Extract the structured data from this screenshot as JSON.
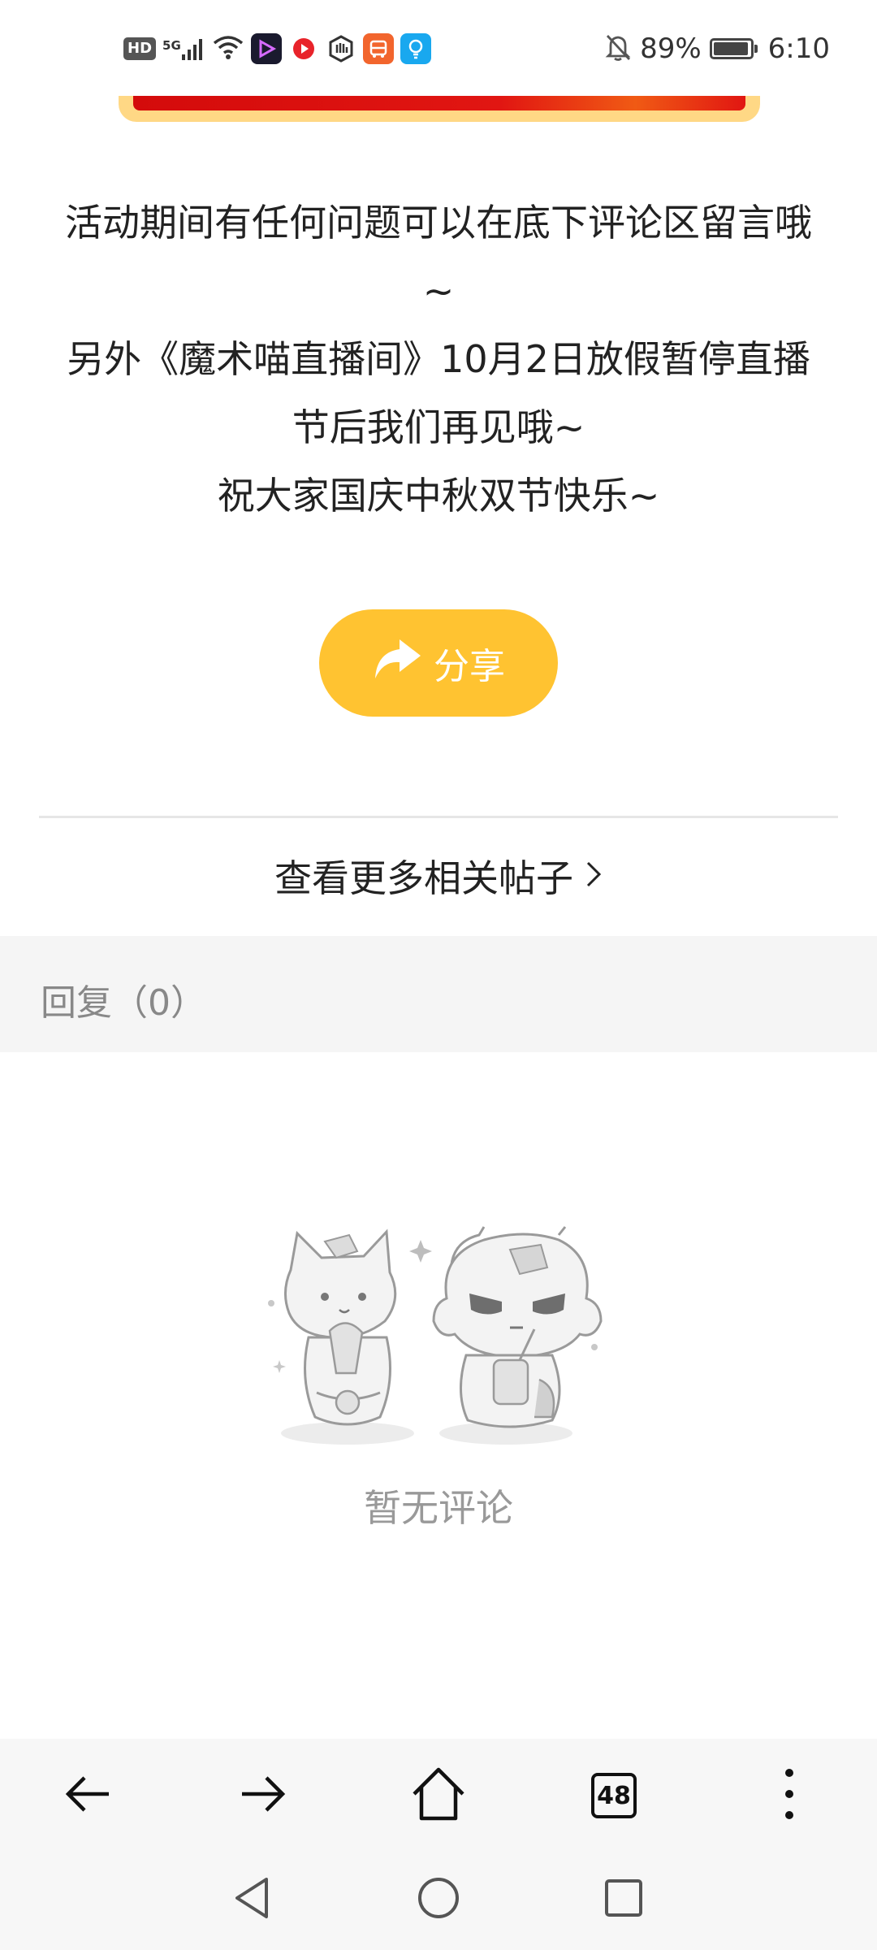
{
  "status_bar": {
    "hd": "HD",
    "network": "5G",
    "battery": "89%",
    "time": "6:10"
  },
  "article": {
    "lines": [
      "活动期间有任何问题可以在底下评论区留言哦",
      "~",
      "另外《魔术喵直播间》10月2日放假暂停直播",
      "节后我们再见哦~",
      "祝大家国庆中秋双节快乐~"
    ]
  },
  "share": {
    "label": "分享"
  },
  "related": {
    "label": "查看更多相关帖子"
  },
  "replies": {
    "title": "回复（0）"
  },
  "empty": {
    "text": "暂无评论"
  },
  "browser": {
    "tab_count": "48"
  },
  "colors": {
    "accent": "#ffc331",
    "banner_red": "#e11612",
    "muted_text": "#999999"
  }
}
